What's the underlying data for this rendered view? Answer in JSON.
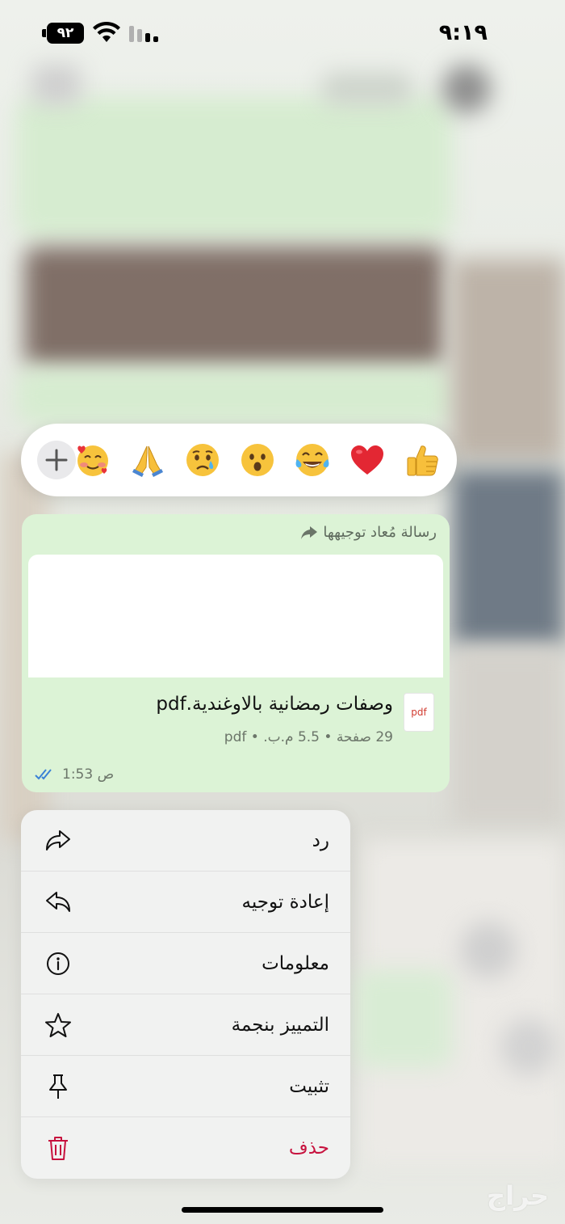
{
  "status_bar": {
    "battery": "٩٢",
    "time": "٩:١٩"
  },
  "reactions": {
    "emojis": [
      "thumbs-up",
      "red-heart",
      "tears-of-joy",
      "astonished-face",
      "crying-face",
      "folded-hands",
      "smiling-face-with-hearts"
    ],
    "add_icon": "plus-icon"
  },
  "message": {
    "forwarded_label": "رسالة مُعاد توجيهها",
    "document_title": "وصفات رمضانية بالاوغندية.pdf",
    "document_meta": "29 صفحة • 5.5 م.ب. • pdf",
    "pdf_badge": "pdf",
    "time": "1:53 ص",
    "read_status": "double-check-blue"
  },
  "menu": {
    "items": [
      {
        "label": "رد",
        "icon": "reply-icon"
      },
      {
        "label": "إعادة توجيه",
        "icon": "forward-icon"
      },
      {
        "label": "معلومات",
        "icon": "info-icon"
      },
      {
        "label": "التمييز بنجمة",
        "icon": "star-icon"
      },
      {
        "label": "تثبيت",
        "icon": "pin-icon"
      },
      {
        "label": "حذف",
        "icon": "trash-icon"
      }
    ]
  },
  "colors": {
    "bubble": "#dcf3d6",
    "delete": "#c7123e",
    "read_ticks": "#3b82d6"
  },
  "watermark": "حراج"
}
